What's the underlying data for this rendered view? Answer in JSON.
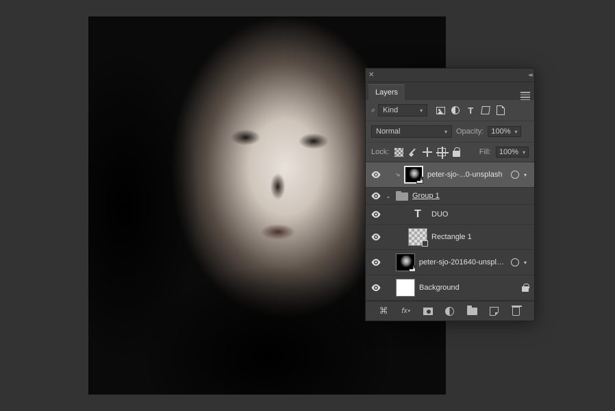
{
  "panel": {
    "tab_label": "Layers",
    "filter": {
      "search_mode": "Kind"
    },
    "blend": {
      "mode": "Normal",
      "opacity_label": "Opacity:",
      "opacity_value": "100%"
    },
    "lock": {
      "label": "Lock:",
      "fill_label": "Fill:",
      "fill_value": "100%"
    },
    "layers": [
      {
        "name": "peter-sjo-...0-unsplash"
      },
      {
        "name": "Group 1"
      },
      {
        "name": "DUO"
      },
      {
        "name": "Rectangle 1"
      },
      {
        "name": "peter-sjo-201640-unsplash"
      },
      {
        "name": "Background"
      }
    ],
    "footer": {
      "fx_label": "fx"
    }
  }
}
